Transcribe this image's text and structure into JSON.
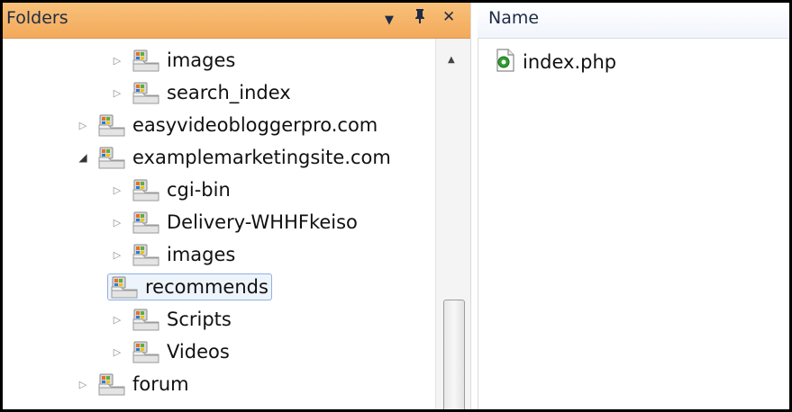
{
  "folders_pane": {
    "title": "Folders",
    "dropdown_glyph": "▼",
    "pin_glyph": "ꟷ",
    "close_glyph": "✕"
  },
  "tree": [
    {
      "label": "images",
      "state": "collapsed",
      "level": 2,
      "icon": "folder-icon"
    },
    {
      "label": "search_index",
      "state": "collapsed",
      "level": 2,
      "icon": "folder-icon"
    },
    {
      "label": "easyvideobloggerpro.com",
      "state": "collapsed",
      "level": 1,
      "icon": "folder-icon"
    },
    {
      "label": "examplemarketingsite.com",
      "state": "expanded",
      "level": 1,
      "icon": "folder-icon"
    },
    {
      "label": "cgi-bin",
      "state": "collapsed",
      "level": 2,
      "icon": "folder-icon"
    },
    {
      "label": "Delivery-WHHFkeiso",
      "state": "collapsed",
      "level": 2,
      "icon": "folder-icon"
    },
    {
      "label": "images",
      "state": "collapsed",
      "level": 2,
      "icon": "folder-icon"
    },
    {
      "label": "recommends",
      "state": "selected",
      "level": 2,
      "icon": "folder-icon"
    },
    {
      "label": "Scripts",
      "state": "collapsed",
      "level": 2,
      "icon": "folder-icon"
    },
    {
      "label": "Videos",
      "state": "collapsed",
      "level": 2,
      "icon": "folder-icon"
    },
    {
      "label": "forum",
      "state": "collapsed",
      "level": 1,
      "icon": "folder-icon"
    }
  ],
  "files_pane": {
    "column_header": "Name",
    "files": [
      {
        "name": "index.php",
        "icon": "php-file-icon"
      }
    ]
  },
  "colors": {
    "header_orange": "#f3a95a",
    "selection_border": "#8db2e3",
    "php_icon_green": "#2f9e2f"
  }
}
